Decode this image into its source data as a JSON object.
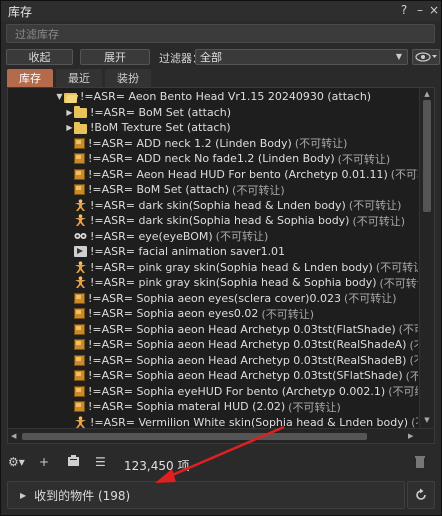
{
  "window": {
    "title": "库存",
    "help": "?",
    "minimize": "–",
    "close": "×"
  },
  "search": {
    "placeholder": "过滤库存"
  },
  "toolbar": {
    "collapse_label": "收起",
    "expand_label": "展开",
    "filter_label": "过滤器：",
    "filter_value": "全部"
  },
  "tabs": [
    {
      "label": "库存"
    },
    {
      "label": "最近"
    },
    {
      "label": "装扮"
    }
  ],
  "tree": [
    {
      "indent": 0,
      "twisty": "down",
      "icon": "folder-open-icon",
      "name": "!=ASR= Aeon Bento Head Vr1.15 20240930 (attach)",
      "suffix": ""
    },
    {
      "indent": 1,
      "twisty": "right",
      "icon": "folder-icon",
      "name": "!=ASR= BoM Set (attach)",
      "suffix": ""
    },
    {
      "indent": 1,
      "twisty": "right",
      "icon": "folder-icon",
      "name": "!BoM Texture Set (attach)",
      "suffix": ""
    },
    {
      "indent": 1,
      "twisty": "",
      "icon": "object-icon",
      "name": "!=ASR=  ADD neck 1.2 (Linden Body)",
      "suffix": "(不可转让)"
    },
    {
      "indent": 1,
      "twisty": "",
      "icon": "object-icon",
      "name": "!=ASR=  ADD neck No fade1.2 (Linden Body)",
      "suffix": "(不可转让)"
    },
    {
      "indent": 1,
      "twisty": "",
      "icon": "object-icon",
      "name": "!=ASR= Aeon Head HUD For bento (Archetyp 0.01.11)",
      "suffix": "(不可转让)"
    },
    {
      "indent": 1,
      "twisty": "",
      "icon": "object-icon",
      "name": "!=ASR= BoM Set (attach)",
      "suffix": "(不可转让)"
    },
    {
      "indent": 1,
      "twisty": "",
      "icon": "body-part-icon",
      "name": "!=ASR= dark skin(Sophia head & Lnden body)",
      "suffix": "(不可转让)"
    },
    {
      "indent": 1,
      "twisty": "",
      "icon": "body-part-icon",
      "name": "!=ASR= dark skin(Sophia head & Sophia  body)",
      "suffix": "(不可转让)"
    },
    {
      "indent": 1,
      "twisty": "",
      "icon": "eyes-icon",
      "name": "!=ASR= eye(eyeBOM)",
      "suffix": "(不可转让)"
    },
    {
      "indent": 1,
      "twisty": "",
      "icon": "animation-icon",
      "name": "!=ASR= facial animation saver1.01",
      "suffix": ""
    },
    {
      "indent": 1,
      "twisty": "",
      "icon": "body-part-icon",
      "name": "!=ASR= pink gray skin(Sophia  head & Lnden body)",
      "suffix": "(不可转让)"
    },
    {
      "indent": 1,
      "twisty": "",
      "icon": "body-part-icon",
      "name": "!=ASR= pink gray skin(Sophia head & Sophia  body)",
      "suffix": "(不可转让)"
    },
    {
      "indent": 1,
      "twisty": "",
      "icon": "object-icon",
      "name": "!=ASR= Sophia aeon eyes(sclera cover)0.023",
      "suffix": "(不可转让)"
    },
    {
      "indent": 1,
      "twisty": "",
      "icon": "object-icon",
      "name": "!=ASR= Sophia aeon eyes0.02",
      "suffix": "(不可转让)"
    },
    {
      "indent": 1,
      "twisty": "",
      "icon": "object-icon",
      "name": "!=ASR= Sophia aeon Head Archetyp 0.03tst(FlatShade)",
      "suffix": "(不可转让)"
    },
    {
      "indent": 1,
      "twisty": "",
      "icon": "object-icon",
      "name": "!=ASR= Sophia aeon Head Archetyp 0.03tst(RealShadeA)",
      "suffix": "(不可转让)"
    },
    {
      "indent": 1,
      "twisty": "",
      "icon": "object-icon",
      "name": "!=ASR= Sophia aeon Head Archetyp 0.03tst(RealShadeB)",
      "suffix": "(不可转让)"
    },
    {
      "indent": 1,
      "twisty": "",
      "icon": "object-icon",
      "name": "!=ASR= Sophia aeon Head Archetyp 0.03tst(SFlatShade)",
      "suffix": "(不可转让)"
    },
    {
      "indent": 1,
      "twisty": "",
      "icon": "object-icon",
      "name": "!=ASR= Sophia eyeHUD For bento (Archetyp 0.002.1)",
      "suffix": "(不可编辑) (不可转"
    },
    {
      "indent": 1,
      "twisty": "",
      "icon": "object-icon",
      "name": "!=ASR= Sophia materal HUD (2.02)",
      "suffix": "(不可转让)"
    },
    {
      "indent": 1,
      "twisty": "",
      "icon": "body-part-icon",
      "name": "!=ASR= Vermilion White skin(Sophia head & Lnden body)",
      "suffix": "(不可转让)"
    }
  ],
  "status": {
    "item_count": "123,450 项"
  },
  "received": {
    "label": "收到的物件 (198)"
  },
  "colors": {
    "active_tab": "#b36b4c",
    "annotation_arrow": "#e02020"
  }
}
